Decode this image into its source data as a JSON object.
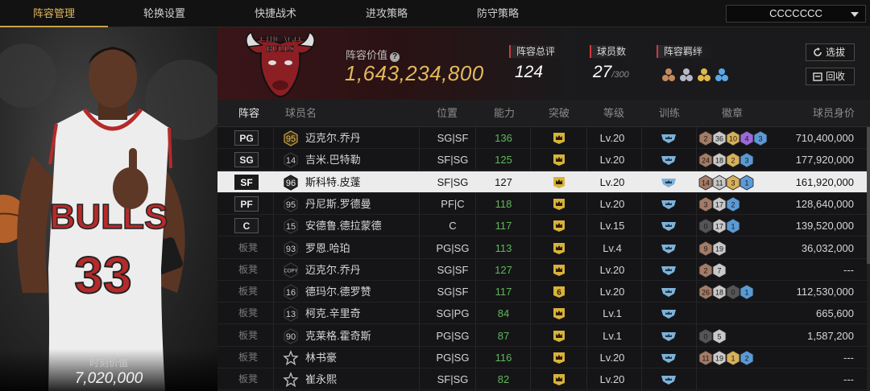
{
  "nav": {
    "tabs": [
      "阵容管理",
      "轮换设置",
      "快捷战术",
      "进攻策略",
      "防守策略"
    ],
    "active_tab": 0,
    "team_select": "CCCCCCC"
  },
  "player": {
    "moment_label": "时刻价值",
    "moment_value": "7,020,000"
  },
  "header": {
    "logo_text": "CHICAGO BULLS",
    "lineup_value_label": "阵容价值",
    "lineup_value": "1,643,234,800",
    "overall_label": "阵容总评",
    "overall_value": "124",
    "player_count_label": "球员数",
    "player_count_value": "27",
    "player_count_max": "/300",
    "bond_label": "阵容羁绊",
    "btn_select": "选拔",
    "btn_recycle": "回收"
  },
  "table": {
    "headers": [
      "阵容",
      "球员名",
      "位置",
      "能力",
      "突破",
      "等级",
      "训练",
      "徽章",
      "球员身价"
    ],
    "rows": [
      {
        "slot": "PG",
        "num": "95",
        "num_style": "gold",
        "name": "迈克尔.乔丹",
        "pos": "SG|SF",
        "ability": "136",
        "brk": "crown",
        "lvl": "Lv.20",
        "badges": [
          {
            "v": "2",
            "c": "#a47b66"
          },
          {
            "v": "36",
            "c": "#c8c8c8"
          },
          {
            "v": "10",
            "c": "#d6b05a"
          },
          {
            "v": "4",
            "c": "#9a6ad6"
          },
          {
            "v": "3",
            "c": "#5a9ad6"
          }
        ],
        "price": "710,400,000"
      },
      {
        "slot": "SG",
        "num": "14",
        "num_style": "plain",
        "name": "吉米.巴特勒",
        "pos": "SF|SG",
        "ability": "125",
        "brk": "crown",
        "lvl": "Lv.20",
        "badges": [
          {
            "v": "24",
            "c": "#a47b66"
          },
          {
            "v": "18",
            "c": "#c8c8c8"
          },
          {
            "v": "2",
            "c": "#d6b05a"
          },
          {
            "v": "3",
            "c": "#5a9ad6"
          }
        ],
        "price": "177,920,000"
      },
      {
        "slot": "SF",
        "num": "96",
        "num_style": "dark",
        "name": "斯科特.皮蓬",
        "pos": "SF|SG",
        "ability": "127",
        "brk": "crown",
        "lvl": "Lv.20",
        "badges": [
          {
            "v": "14",
            "c": "#a47b66"
          },
          {
            "v": "11",
            "c": "#c8c8c8"
          },
          {
            "v": "3",
            "c": "#d6b05a"
          },
          {
            "v": "1",
            "c": "#5a9ad6"
          }
        ],
        "price": "161,920,000",
        "selected": true
      },
      {
        "slot": "PF",
        "num": "95",
        "num_style": "plain",
        "name": "丹尼斯.罗德曼",
        "pos": "PF|C",
        "ability": "118",
        "brk": "crown",
        "lvl": "Lv.20",
        "badges": [
          {
            "v": "3",
            "c": "#a47b66"
          },
          {
            "v": "17",
            "c": "#c8c8c8"
          },
          {
            "v": "2",
            "c": "#5a9ad6"
          }
        ],
        "price": "128,640,000"
      },
      {
        "slot": "C",
        "num": "15",
        "num_style": "plain",
        "name": "安德鲁.德拉蒙德",
        "pos": "C",
        "ability": "117",
        "brk": "crown",
        "lvl": "Lv.15",
        "badges": [
          {
            "v": "0",
            "c": "#555555"
          },
          {
            "v": "17",
            "c": "#c8c8c8"
          },
          {
            "v": "1",
            "c": "#5a9ad6"
          }
        ],
        "price": "139,520,000"
      },
      {
        "slot": "板凳",
        "num": "93",
        "num_style": "plain",
        "name": "罗恩.哈珀",
        "pos": "PG|SG",
        "ability": "113",
        "brk": "crown",
        "lvl": "Lv.4",
        "badges": [
          {
            "v": "9",
            "c": "#a47b66"
          },
          {
            "v": "19",
            "c": "#c8c8c8"
          }
        ],
        "price": "36,032,000"
      },
      {
        "slot": "板凳",
        "num": "COPY",
        "num_style": "copy",
        "name": "迈克尔.乔丹",
        "pos": "SG|SF",
        "ability": "127",
        "brk": "crown",
        "lvl": "Lv.20",
        "badges": [
          {
            "v": "2",
            "c": "#a47b66"
          },
          {
            "v": "7",
            "c": "#c8c8c8"
          }
        ],
        "price": "---"
      },
      {
        "slot": "板凳",
        "num": "16",
        "num_style": "plain",
        "name": "德玛尔.德罗赞",
        "pos": "SG|SF",
        "ability": "117",
        "brk": "six",
        "lvl": "Lv.20",
        "badges": [
          {
            "v": "26",
            "c": "#a47b66"
          },
          {
            "v": "18",
            "c": "#c8c8c8"
          },
          {
            "v": "0",
            "c": "#555555"
          },
          {
            "v": "1",
            "c": "#5a9ad6"
          }
        ],
        "price": "112,530,000"
      },
      {
        "slot": "板凳",
        "num": "13",
        "num_style": "plain",
        "name": "柯克.辛里奇",
        "pos": "SG|PG",
        "ability": "84",
        "brk": "crown",
        "lvl": "Lv.1",
        "badges": [],
        "price": "665,600"
      },
      {
        "slot": "板凳",
        "num": "90",
        "num_style": "plain",
        "name": "克莱格.霍奇斯",
        "pos": "PG|SG",
        "ability": "87",
        "brk": "crown",
        "lvl": "Lv.1",
        "badges": [
          {
            "v": "0",
            "c": "#555555"
          },
          {
            "v": "5",
            "c": "#c8c8c8"
          }
        ],
        "price": "1,587,200"
      },
      {
        "slot": "板凳",
        "num": "star",
        "num_style": "star",
        "name": "林书豪",
        "pos": "PG|SG",
        "ability": "116",
        "brk": "crown",
        "lvl": "Lv.20",
        "badges": [
          {
            "v": "11",
            "c": "#a47b66"
          },
          {
            "v": "19",
            "c": "#c8c8c8"
          },
          {
            "v": "1",
            "c": "#d6b05a"
          },
          {
            "v": "2",
            "c": "#5a9ad6"
          }
        ],
        "price": "---"
      },
      {
        "slot": "板凳",
        "num": "star",
        "num_style": "star",
        "name": "崔永熙",
        "pos": "SF|SG",
        "ability": "82",
        "brk": "crown",
        "lvl": "Lv.20",
        "badges": [],
        "price": "---"
      }
    ]
  }
}
